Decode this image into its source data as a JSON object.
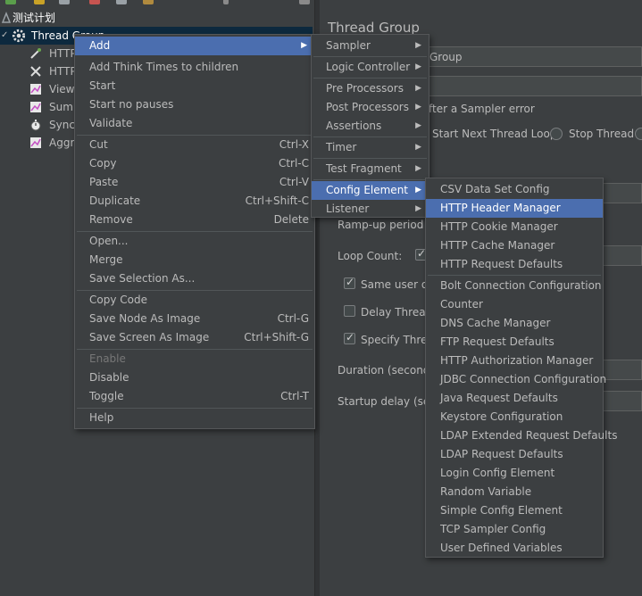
{
  "tree": {
    "root": "测试计划",
    "thread_group": "Thread Group",
    "children": [
      "HTTP",
      "HTTP",
      "View",
      "Summ",
      "Synch",
      "Aggre"
    ]
  },
  "panel": {
    "title": "Thread Group",
    "name_value": "Group",
    "error_label": "fter a Sampler error",
    "start_next": "Start Next Thread Loop",
    "stop_thread": "Stop Thread",
    "ramp_up": "Ramp-up period (s",
    "loop_count": "Loop Count:",
    "same_user": "Same user on",
    "delay_thread": "Delay Thread",
    "specify_thread": "Specify Threa",
    "duration": "Duration (seconds)",
    "startup_delay": "Startup delay (seco"
  },
  "context_menu": {
    "add": "Add",
    "add_think_times": "Add Think Times to children",
    "start": "Start",
    "start_no_pauses": "Start no pauses",
    "validate": "Validate",
    "cut": "Cut",
    "cut_sc": "Ctrl-X",
    "copy": "Copy",
    "copy_sc": "Ctrl-C",
    "paste": "Paste",
    "paste_sc": "Ctrl-V",
    "duplicate": "Duplicate",
    "duplicate_sc": "Ctrl+Shift-C",
    "remove": "Remove",
    "remove_sc": "Delete",
    "open": "Open...",
    "merge": "Merge",
    "save_selection": "Save Selection As...",
    "copy_code": "Copy Code",
    "save_node_image": "Save Node As Image",
    "save_node_image_sc": "Ctrl-G",
    "save_screen_image": "Save Screen As Image",
    "save_screen_image_sc": "Ctrl+Shift-G",
    "enable": "Enable",
    "disable": "Disable",
    "toggle": "Toggle",
    "toggle_sc": "Ctrl-T",
    "help": "Help"
  },
  "add_submenu": {
    "sampler": "Sampler",
    "logic_controller": "Logic Controller",
    "pre_processors": "Pre Processors",
    "post_processors": "Post Processors",
    "assertions": "Assertions",
    "timer": "Timer",
    "test_fragment": "Test Fragment",
    "config_element": "Config Element",
    "listener": "Listener"
  },
  "config_submenu": [
    "CSV Data Set Config",
    "HTTP Header Manager",
    "HTTP Cookie Manager",
    "HTTP Cache Manager",
    "HTTP Request Defaults",
    "Bolt Connection Configuration",
    "Counter",
    "DNS Cache Manager",
    "FTP Request Defaults",
    "HTTP Authorization Manager",
    "JDBC Connection Configuration",
    "Java Request Defaults",
    "Keystore Configuration",
    "LDAP Extended Request Defaults",
    "LDAP Request Defaults",
    "Login Config Element",
    "Random Variable",
    "Simple Config Element",
    "TCP Sampler Config",
    "User Defined Variables"
  ],
  "icons": {
    "arrow": "submenu-arrow-icon",
    "checkmark": "check-icon"
  },
  "colors": {
    "background": "#3c3f41",
    "selection": "#4b6eaf",
    "text": "#bbbbbb",
    "disabled_text": "#777777"
  }
}
